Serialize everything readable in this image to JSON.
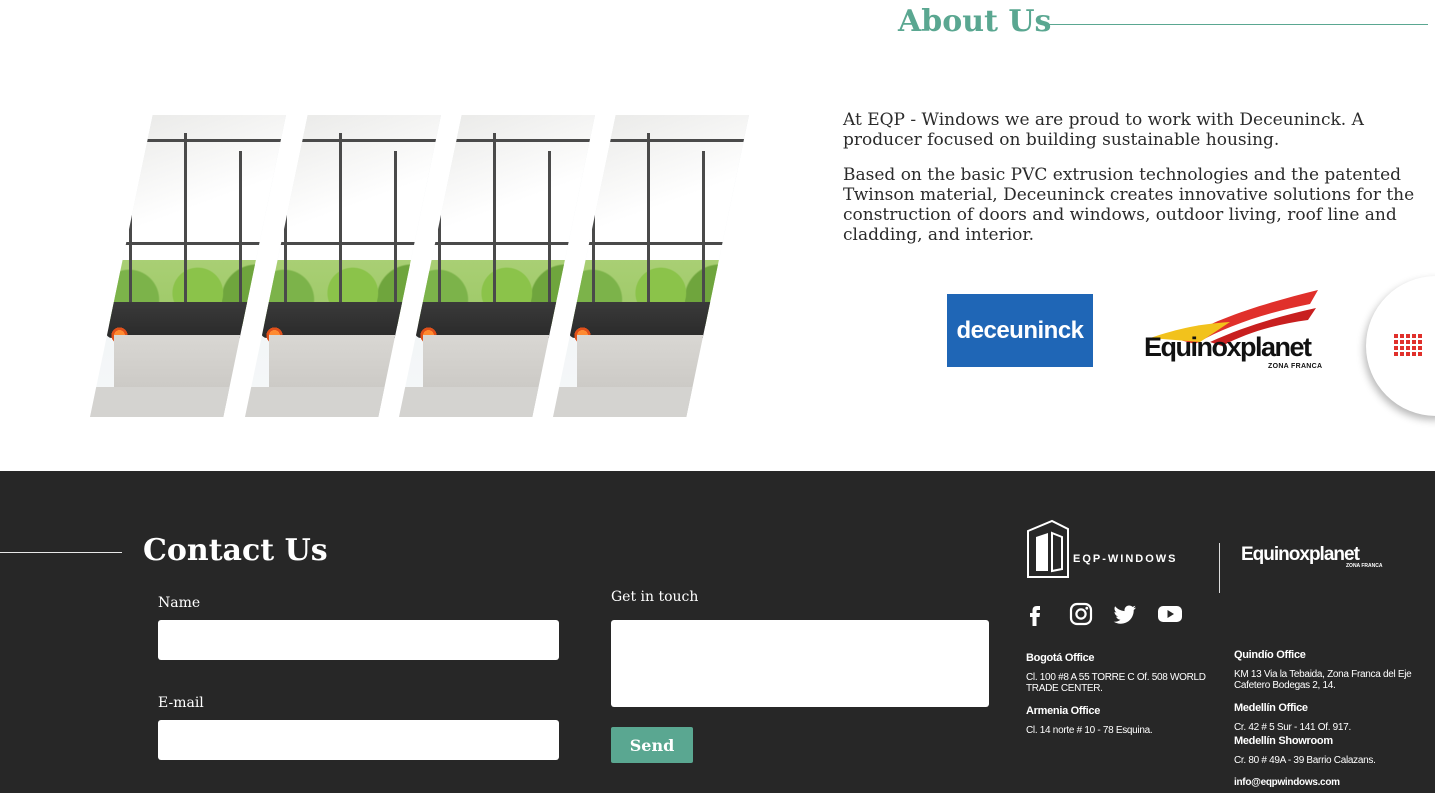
{
  "about": {
    "title_bold": "About",
    "title_rest": " Us",
    "paragraphs": [
      "At EQP  - Windows we are proud to work with Deceuninck. A producer focused on building sustainable housing.",
      "Based on the basic PVC extrusion technologies and the patented Twinson material, Deceuninck creates innovative solutions for the construction of doors and windows, outdoor living, roof line and cladding, and interior."
    ],
    "logos": {
      "deceuninck": "deceuninck",
      "equinox": "Equinoxplanet",
      "equinox_sub": "ZONA FRANCA"
    }
  },
  "contact": {
    "title_bold": "Contact",
    "title_rest": " Us",
    "name_label": "Name",
    "email_label": "E-mail",
    "message_label": "Get in touch",
    "send_label": "Send",
    "name_value": "",
    "email_value": "",
    "message_value": ""
  },
  "brands": {
    "eqp": "EQP-WINDOWS",
    "equinox": "Equinoxplanet",
    "equinox_sub": "ZONA FRANCA"
  },
  "social": [
    "facebook-icon",
    "instagram-icon",
    "twitter-icon",
    "youtube-icon"
  ],
  "offices": {
    "bogota": {
      "name": "Bogotá Office",
      "address": "Cl. 100 #8 A 55 TORRE C Of. 508 WORLD TRADE CENTER."
    },
    "armenia": {
      "name": "Armenia Office",
      "address": "Cl. 14 norte # 10 - 78 Esquina."
    },
    "quindio": {
      "name": "Quindío Office",
      "address": "KM 13 Via la Tebaida, Zona Franca del Eje Cafetero Bodegas 2, 14."
    },
    "medellin": {
      "name": "Medellín Office",
      "address": "Cr. 42 # 5 Sur - 141 Of. 917."
    },
    "showroom": {
      "name": "Medellín Showroom",
      "address": "Cr. 80 # 49A - 39 Barrio Calazans."
    },
    "email": "info@eqpwindows.com"
  },
  "colors": {
    "accent": "#5aa791",
    "footer_bg": "#272727",
    "deceuninck_blue": "#1f66b6",
    "menu_red": "#e0302b"
  }
}
